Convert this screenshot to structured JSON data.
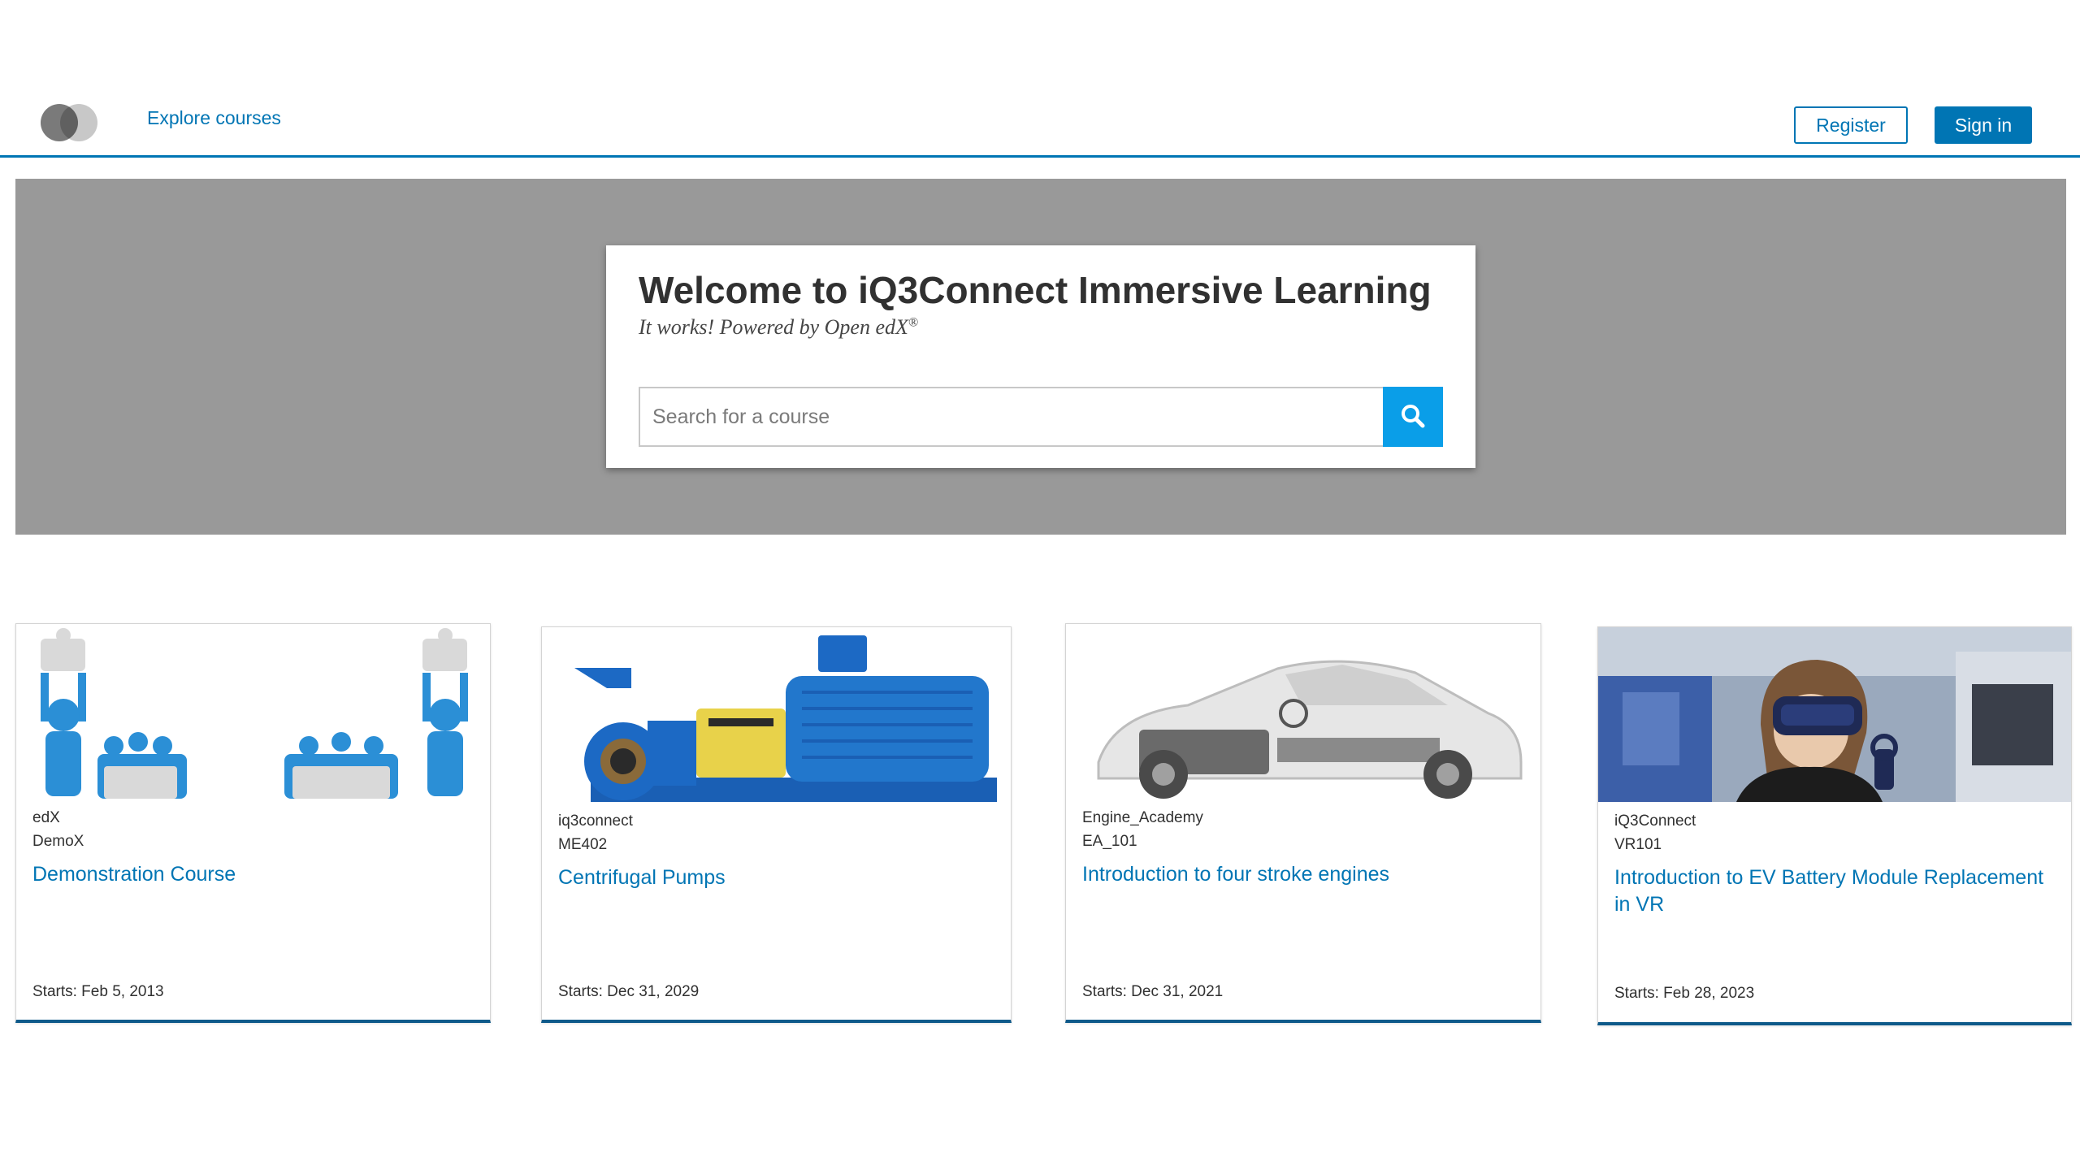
{
  "header": {
    "nav_explore": "Explore courses",
    "register_label": "Register",
    "signin_label": "Sign in"
  },
  "hero": {
    "title": "Welcome to iQ3Connect Immersive Learning",
    "subtitle": "It works! Powered by Open edX",
    "subtitle_mark": "®",
    "search_placeholder": "Search for a course"
  },
  "courses": [
    {
      "org": "edX",
      "number": "DemoX",
      "title": "Demonstration Course",
      "starts": "Starts: Feb 5, 2013"
    },
    {
      "org": "iq3connect",
      "number": "ME402",
      "title": "Centrifugal Pumps",
      "starts": "Starts: Dec 31, 2029"
    },
    {
      "org": "Engine_Academy",
      "number": "EA_101",
      "title": "Introduction to four stroke engines",
      "starts": "Starts: Dec 31, 2021"
    },
    {
      "org": "iQ3Connect",
      "number": "VR101",
      "title": "Introduction to EV Battery Module Replacement in VR",
      "starts": "Starts: Feb 28, 2023"
    }
  ],
  "colors": {
    "brand": "#0075b4",
    "search_button": "#0a9ee8",
    "hero_bg": "#999999"
  },
  "icons": {
    "search": "search-icon",
    "logo": "logo-icon"
  }
}
